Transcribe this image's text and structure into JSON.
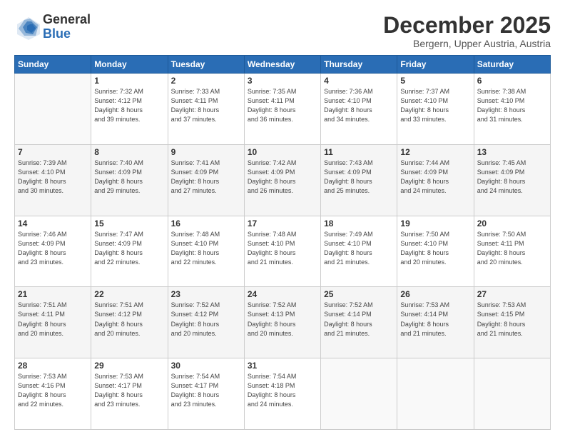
{
  "logo": {
    "general": "General",
    "blue": "Blue"
  },
  "header": {
    "month": "December 2025",
    "location": "Bergern, Upper Austria, Austria"
  },
  "days_of_week": [
    "Sunday",
    "Monday",
    "Tuesday",
    "Wednesday",
    "Thursday",
    "Friday",
    "Saturday"
  ],
  "weeks": [
    [
      {
        "day": "",
        "info": ""
      },
      {
        "day": "1",
        "info": "Sunrise: 7:32 AM\nSunset: 4:12 PM\nDaylight: 8 hours\nand 39 minutes."
      },
      {
        "day": "2",
        "info": "Sunrise: 7:33 AM\nSunset: 4:11 PM\nDaylight: 8 hours\nand 37 minutes."
      },
      {
        "day": "3",
        "info": "Sunrise: 7:35 AM\nSunset: 4:11 PM\nDaylight: 8 hours\nand 36 minutes."
      },
      {
        "day": "4",
        "info": "Sunrise: 7:36 AM\nSunset: 4:10 PM\nDaylight: 8 hours\nand 34 minutes."
      },
      {
        "day": "5",
        "info": "Sunrise: 7:37 AM\nSunset: 4:10 PM\nDaylight: 8 hours\nand 33 minutes."
      },
      {
        "day": "6",
        "info": "Sunrise: 7:38 AM\nSunset: 4:10 PM\nDaylight: 8 hours\nand 31 minutes."
      }
    ],
    [
      {
        "day": "7",
        "info": "Sunrise: 7:39 AM\nSunset: 4:10 PM\nDaylight: 8 hours\nand 30 minutes."
      },
      {
        "day": "8",
        "info": "Sunrise: 7:40 AM\nSunset: 4:09 PM\nDaylight: 8 hours\nand 29 minutes."
      },
      {
        "day": "9",
        "info": "Sunrise: 7:41 AM\nSunset: 4:09 PM\nDaylight: 8 hours\nand 27 minutes."
      },
      {
        "day": "10",
        "info": "Sunrise: 7:42 AM\nSunset: 4:09 PM\nDaylight: 8 hours\nand 26 minutes."
      },
      {
        "day": "11",
        "info": "Sunrise: 7:43 AM\nSunset: 4:09 PM\nDaylight: 8 hours\nand 25 minutes."
      },
      {
        "day": "12",
        "info": "Sunrise: 7:44 AM\nSunset: 4:09 PM\nDaylight: 8 hours\nand 24 minutes."
      },
      {
        "day": "13",
        "info": "Sunrise: 7:45 AM\nSunset: 4:09 PM\nDaylight: 8 hours\nand 24 minutes."
      }
    ],
    [
      {
        "day": "14",
        "info": "Sunrise: 7:46 AM\nSunset: 4:09 PM\nDaylight: 8 hours\nand 23 minutes."
      },
      {
        "day": "15",
        "info": "Sunrise: 7:47 AM\nSunset: 4:09 PM\nDaylight: 8 hours\nand 22 minutes."
      },
      {
        "day": "16",
        "info": "Sunrise: 7:48 AM\nSunset: 4:10 PM\nDaylight: 8 hours\nand 22 minutes."
      },
      {
        "day": "17",
        "info": "Sunrise: 7:48 AM\nSunset: 4:10 PM\nDaylight: 8 hours\nand 21 minutes."
      },
      {
        "day": "18",
        "info": "Sunrise: 7:49 AM\nSunset: 4:10 PM\nDaylight: 8 hours\nand 21 minutes."
      },
      {
        "day": "19",
        "info": "Sunrise: 7:50 AM\nSunset: 4:10 PM\nDaylight: 8 hours\nand 20 minutes."
      },
      {
        "day": "20",
        "info": "Sunrise: 7:50 AM\nSunset: 4:11 PM\nDaylight: 8 hours\nand 20 minutes."
      }
    ],
    [
      {
        "day": "21",
        "info": "Sunrise: 7:51 AM\nSunset: 4:11 PM\nDaylight: 8 hours\nand 20 minutes."
      },
      {
        "day": "22",
        "info": "Sunrise: 7:51 AM\nSunset: 4:12 PM\nDaylight: 8 hours\nand 20 minutes."
      },
      {
        "day": "23",
        "info": "Sunrise: 7:52 AM\nSunset: 4:12 PM\nDaylight: 8 hours\nand 20 minutes."
      },
      {
        "day": "24",
        "info": "Sunrise: 7:52 AM\nSunset: 4:13 PM\nDaylight: 8 hours\nand 20 minutes."
      },
      {
        "day": "25",
        "info": "Sunrise: 7:52 AM\nSunset: 4:14 PM\nDaylight: 8 hours\nand 21 minutes."
      },
      {
        "day": "26",
        "info": "Sunrise: 7:53 AM\nSunset: 4:14 PM\nDaylight: 8 hours\nand 21 minutes."
      },
      {
        "day": "27",
        "info": "Sunrise: 7:53 AM\nSunset: 4:15 PM\nDaylight: 8 hours\nand 21 minutes."
      }
    ],
    [
      {
        "day": "28",
        "info": "Sunrise: 7:53 AM\nSunset: 4:16 PM\nDaylight: 8 hours\nand 22 minutes."
      },
      {
        "day": "29",
        "info": "Sunrise: 7:53 AM\nSunset: 4:17 PM\nDaylight: 8 hours\nand 23 minutes."
      },
      {
        "day": "30",
        "info": "Sunrise: 7:54 AM\nSunset: 4:17 PM\nDaylight: 8 hours\nand 23 minutes."
      },
      {
        "day": "31",
        "info": "Sunrise: 7:54 AM\nSunset: 4:18 PM\nDaylight: 8 hours\nand 24 minutes."
      },
      {
        "day": "",
        "info": ""
      },
      {
        "day": "",
        "info": ""
      },
      {
        "day": "",
        "info": ""
      }
    ]
  ]
}
